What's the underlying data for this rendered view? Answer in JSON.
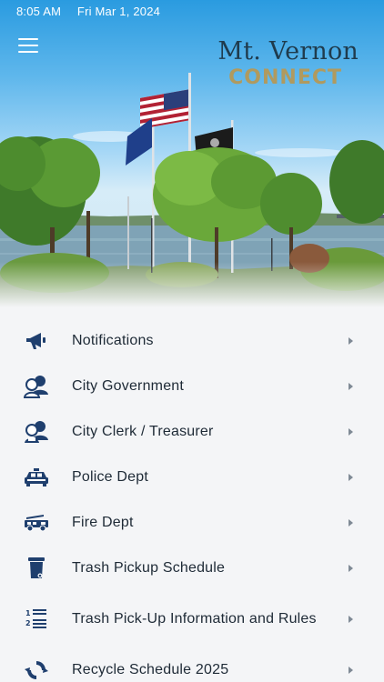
{
  "status_bar": {
    "time": "8:05 AM",
    "date": "Fri Mar 1, 2024"
  },
  "header": {
    "menu_icon": "hamburger-menu-icon",
    "brand_title": "Mt. Vernon",
    "brand_subtitle": "CONNECT"
  },
  "menu": {
    "items": [
      {
        "label": "Notifications",
        "icon": "megaphone-icon"
      },
      {
        "label": "City Government",
        "icon": "people-group-icon"
      },
      {
        "label": "City Clerk / Treasurer",
        "icon": "clerk-people-icon"
      },
      {
        "label": "Police Dept",
        "icon": "police-car-icon"
      },
      {
        "label": "Fire Dept",
        "icon": "fire-truck-icon"
      },
      {
        "label": "Trash Pickup Schedule",
        "icon": "trash-bin-icon"
      },
      {
        "label": "Trash Pick-Up Information and Rules",
        "icon": "numbered-list-icon"
      },
      {
        "label": "Recycle Schedule 2025",
        "icon": "recycle-icon"
      }
    ]
  },
  "colors": {
    "icon": "#1f3f6e",
    "brand_dark": "#1f3b4d",
    "brand_gold": "#b09a5f",
    "chevron": "#7f8a95"
  }
}
